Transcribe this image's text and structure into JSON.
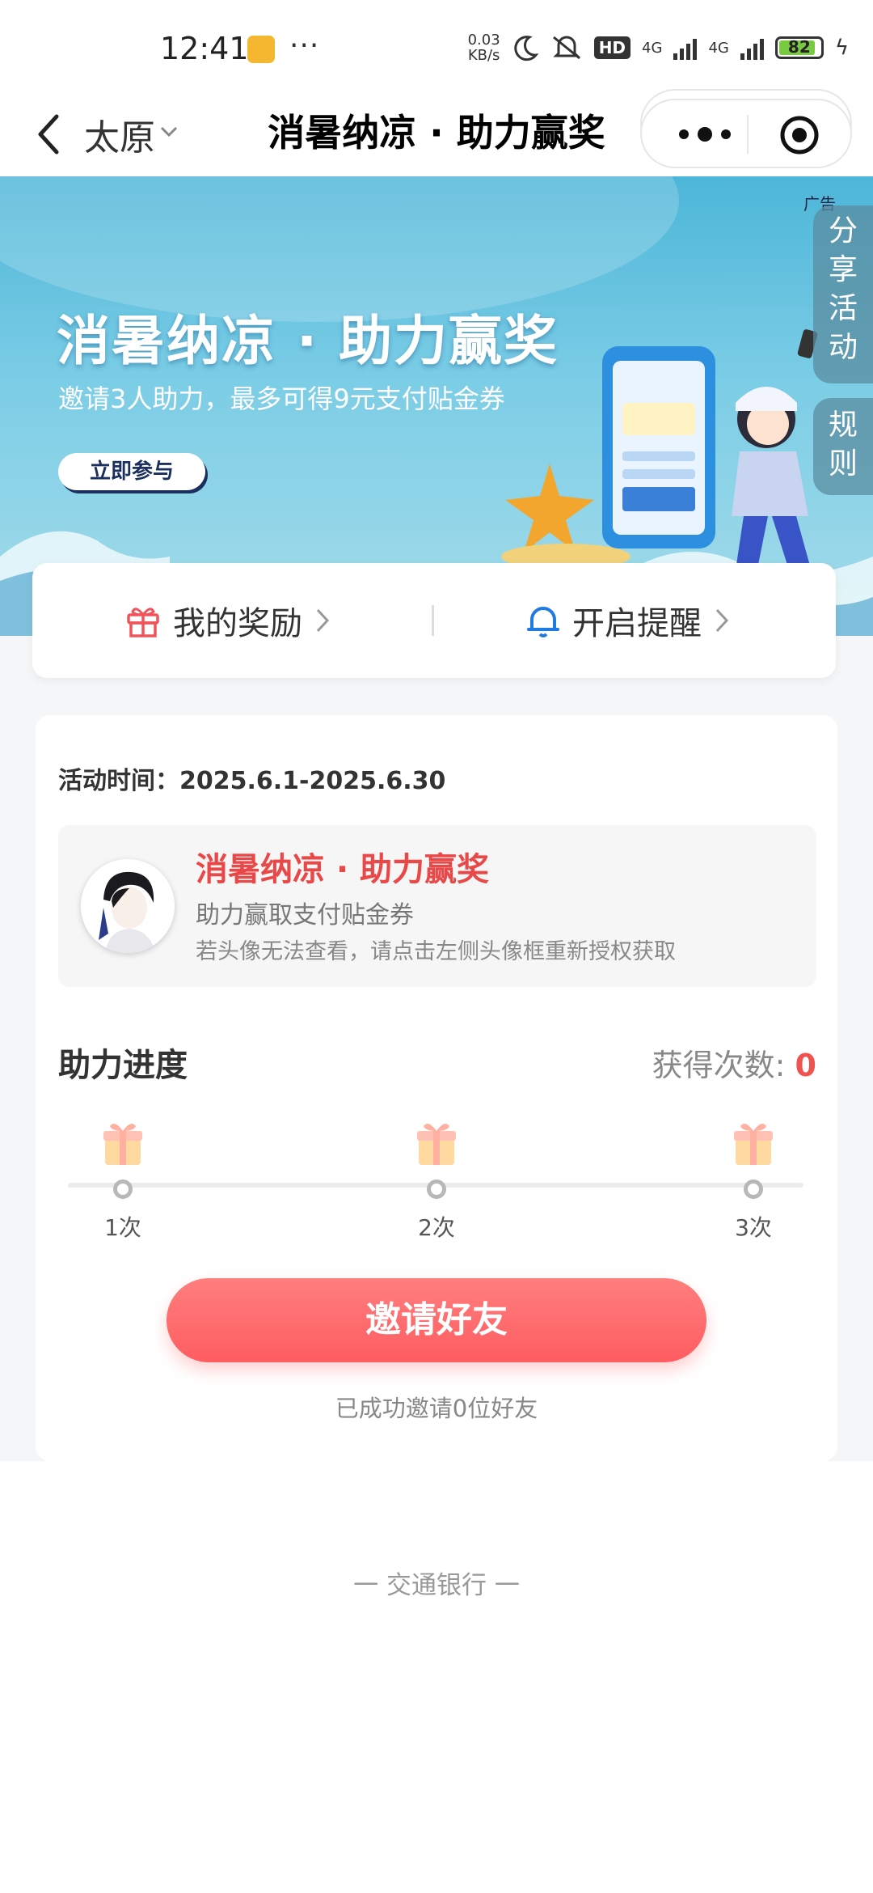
{
  "status_bar": {
    "time": "12:41",
    "dots": "···",
    "speed_top": "0.03",
    "speed_bottom": "KB/s",
    "hd": "HD",
    "net1": "4G",
    "net2": "4G",
    "battery": "82"
  },
  "nav": {
    "city": "太原",
    "title": "消暑纳凉 · 助力赢奖"
  },
  "banner": {
    "ad_label": "广告",
    "title": "消暑纳凉 · 助力赢奖",
    "subtitle": "邀请3人助力，最多可得9元支付贴金券",
    "cta": "立即参与",
    "side_share": "分享活动",
    "side_rule": "规则"
  },
  "shortcuts": {
    "rewards": "我的奖励",
    "reminder": "开启提醒"
  },
  "activity": {
    "time_label": "活动时间：2025.6.1-2025.6.30",
    "title": "消暑纳凉 · 助力赢奖",
    "subtitle": "助力赢取支付贴金券",
    "note": "若头像无法查看，请点击左侧头像框重新授权获取"
  },
  "progress": {
    "label": "助力进度",
    "count_label": "获得次数: ",
    "count_value": "0",
    "milestones": [
      "1次",
      "2次",
      "3次"
    ]
  },
  "invite": {
    "button": "邀请好友",
    "note": "已成功邀请0位好友"
  },
  "footer": {
    "brand": "一 交通银行 一"
  },
  "colors": {
    "accent_red": "#fe5d61",
    "title_red": "#e94848",
    "banner_blue": "#4db6d8"
  }
}
